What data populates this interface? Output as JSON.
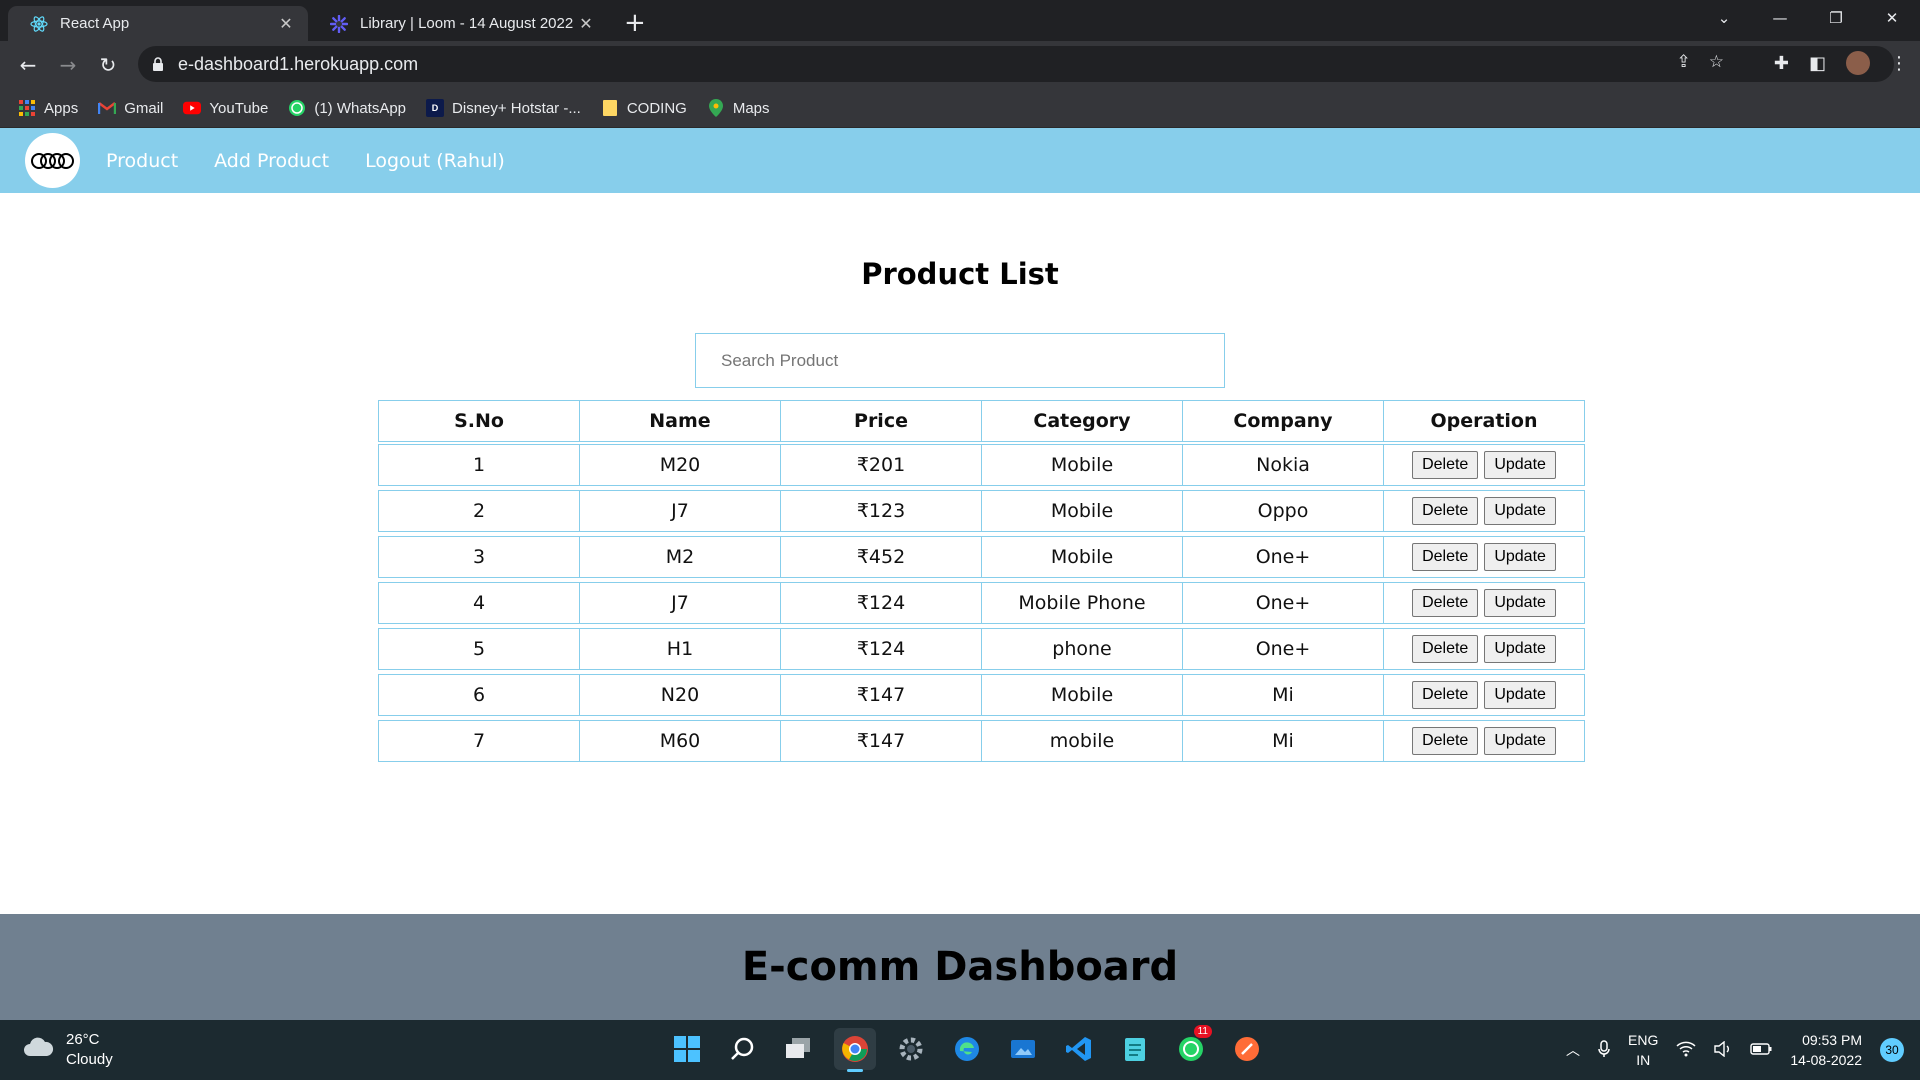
{
  "browser": {
    "tabs": [
      {
        "title": "React App",
        "active": true,
        "icon": "react-icon"
      },
      {
        "title": "Library | Loom - 14 August 2022",
        "active": false,
        "icon": "loom-icon"
      }
    ],
    "url": "e-dashboard1.herokuapp.com",
    "bookmarks": [
      {
        "label": "Apps",
        "icon": "apps-grid-icon"
      },
      {
        "label": "Gmail",
        "icon": "gmail-icon"
      },
      {
        "label": "YouTube",
        "icon": "youtube-icon"
      },
      {
        "label": "(1) WhatsApp",
        "icon": "whatsapp-icon"
      },
      {
        "label": "Disney+ Hotstar -...",
        "icon": "hotstar-icon"
      },
      {
        "label": "CODING",
        "icon": "folder-icon"
      },
      {
        "label": "Maps",
        "icon": "maps-icon"
      }
    ]
  },
  "nav": {
    "links": [
      "Product",
      "Add Product",
      "Logout (Rahul)"
    ]
  },
  "page": {
    "title": "Product List",
    "search_placeholder": "Search Product"
  },
  "table": {
    "headers": [
      "S.No",
      "Name",
      "Price",
      "Category",
      "Company",
      "Operation"
    ],
    "rows": [
      {
        "sno": "1",
        "name": "M20",
        "price": "₹201",
        "category": "Mobile",
        "company": "Nokia"
      },
      {
        "sno": "2",
        "name": "J7",
        "price": "₹123",
        "category": "Mobile",
        "company": "Oppo"
      },
      {
        "sno": "3",
        "name": "M2",
        "price": "₹452",
        "category": "Mobile",
        "company": "One+"
      },
      {
        "sno": "4",
        "name": "J7",
        "price": "₹124",
        "category": "Mobile Phone",
        "company": "One+"
      },
      {
        "sno": "5",
        "name": "H1",
        "price": "₹124",
        "category": "phone",
        "company": "One+"
      },
      {
        "sno": "6",
        "name": "N20",
        "price": "₹147",
        "category": "Mobile",
        "company": "Mi"
      },
      {
        "sno": "7",
        "name": "M60",
        "price": "₹147",
        "category": "mobile",
        "company": "Mi"
      }
    ],
    "delete_label": "Delete",
    "update_label": "Update"
  },
  "footer": {
    "title": "E-comm Dashboard"
  },
  "taskbar": {
    "weather_temp": "26°C",
    "weather_desc": "Cloudy",
    "lang_top": "ENG",
    "lang_bottom": "IN",
    "time": "09:53 PM",
    "date": "14-08-2022",
    "notifications": "30",
    "whatsapp_badge": "11"
  },
  "colors": {
    "nav_bg": "#87ceeb",
    "footer_bg": "#708090",
    "table_border": "#87ceeb"
  }
}
